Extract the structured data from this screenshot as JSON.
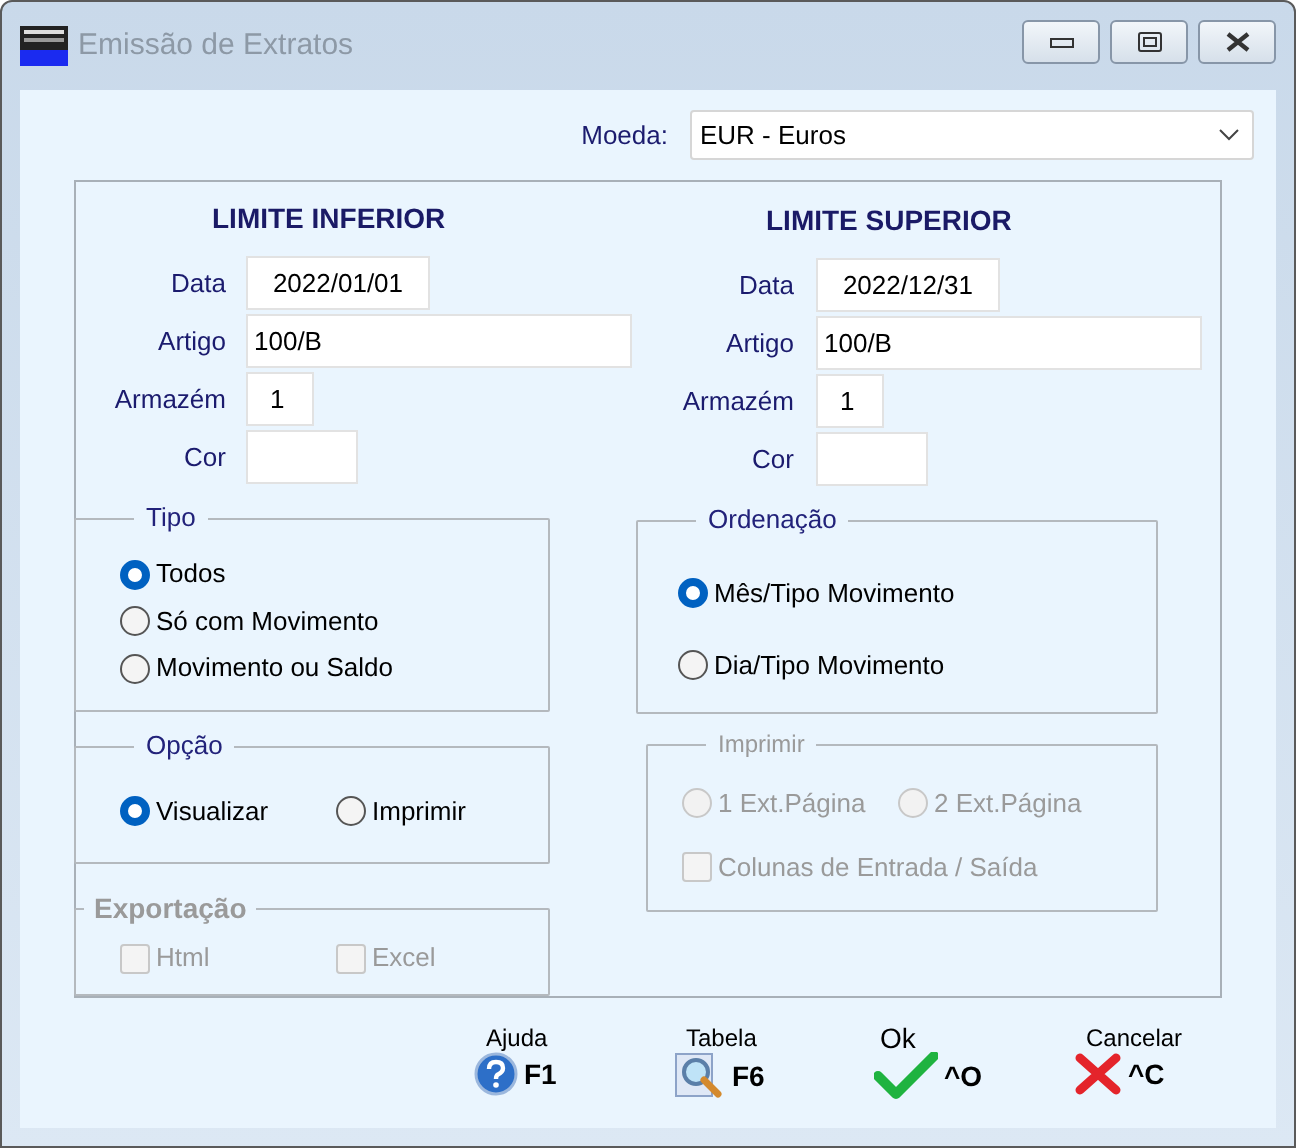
{
  "window": {
    "title": "Emissão de Extratos"
  },
  "currency": {
    "label": "Moeda:",
    "value": "EUR - Euros"
  },
  "limits": [
    {
      "title": "LIMITE INFERIOR",
      "fields": [
        {
          "label": "Data",
          "value": "2022/01/01",
          "kind": "date"
        },
        {
          "label": "Artigo",
          "value": "100/B",
          "kind": "long"
        },
        {
          "label": "Armazém",
          "value": "1",
          "kind": "short"
        },
        {
          "label": "Cor",
          "kind": "medium"
        }
      ]
    },
    {
      "title": "LIMITE SUPERIOR",
      "fields": [
        {
          "label": "Data",
          "value": "2022/12/31",
          "kind": "date"
        },
        {
          "label": "Artigo",
          "value": "100/B",
          "kind": "long"
        },
        {
          "label": "Armazém",
          "value": "1",
          "kind": "short"
        },
        {
          "label": "Cor",
          "kind": "medium"
        }
      ]
    }
  ],
  "left_groups": [
    {
      "title": "Tipo",
      "disabled": false,
      "rows": [
        [
          {
            "kind": "radio",
            "label": "Todos",
            "selected": true
          }
        ],
        [
          {
            "kind": "radio",
            "label": "Só com Movimento",
            "selected": false
          }
        ],
        [
          {
            "kind": "radio",
            "label": "Movimento ou Saldo",
            "selected": false
          }
        ]
      ]
    },
    {
      "title": "Opção",
      "disabled": false,
      "rows": [
        [
          {
            "kind": "radio",
            "label": "Visualizar",
            "selected": true
          },
          {
            "kind": "radio",
            "label": "Imprimir",
            "selected": false
          }
        ]
      ]
    },
    {
      "title": "Exportação",
      "disabled": true,
      "rows": [
        [
          {
            "kind": "checkbox",
            "label": "Html",
            "checked": false
          },
          {
            "kind": "checkbox",
            "label": "Excel",
            "checked": false
          }
        ]
      ]
    }
  ],
  "right_groups": [
    {
      "title": "Ordenação",
      "disabled": false,
      "rows": [
        [
          {
            "kind": "radio",
            "label": "Mês/Tipo Movimento",
            "selected": true
          }
        ],
        [
          {
            "kind": "radio",
            "label": "Dia/Tipo Movimento",
            "selected": false
          }
        ]
      ]
    },
    {
      "title": "Imprimir",
      "disabled": true,
      "rows": [
        [
          {
            "kind": "radio",
            "label": "1 Ext.Página",
            "selected": false
          },
          {
            "kind": "radio",
            "label": "2 Ext.Página",
            "selected": false
          }
        ],
        [
          {
            "kind": "checkbox",
            "label": "Colunas de Entrada / Saída",
            "checked": false
          }
        ]
      ]
    }
  ],
  "buttons": [
    {
      "kind": "help",
      "label": "Ajuda",
      "key": "F1"
    },
    {
      "kind": "table",
      "label": "Tabela",
      "key": "F6"
    },
    {
      "kind": "ok",
      "label": "Ok",
      "key": "^O"
    },
    {
      "kind": "cancel",
      "label": "Cancelar",
      "key": "^C"
    }
  ]
}
